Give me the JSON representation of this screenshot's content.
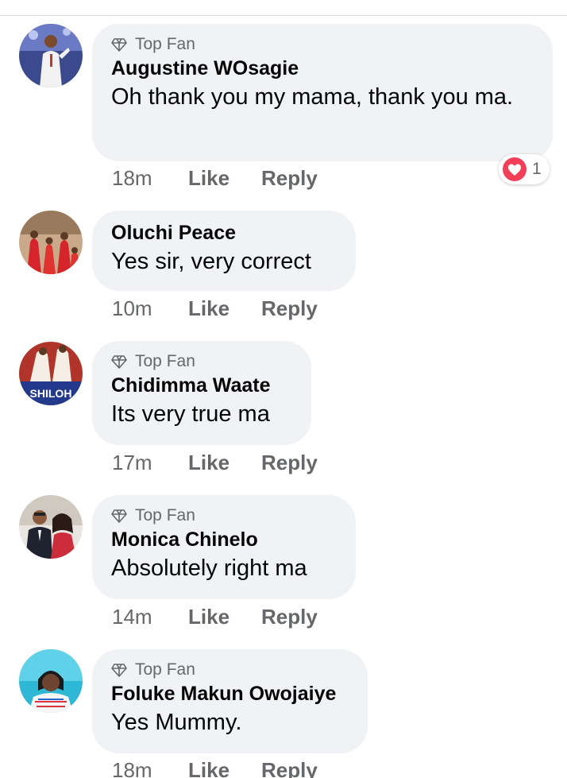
{
  "comments": [
    {
      "badge": "Top Fan",
      "name": "Augustine WOsagie",
      "text": "Oh thank you my mama, thank you ma.",
      "time": "18m",
      "like": "Like",
      "reply": "Reply",
      "reaction": {
        "icon": "heart-reaction-icon",
        "count": "1"
      }
    },
    {
      "name": "Oluchi Peace",
      "text": "Yes sir, very correct",
      "time": "10m",
      "like": "Like",
      "reply": "Reply"
    },
    {
      "badge": "Top Fan",
      "name": "Chidimma Waate",
      "text": "Its very true ma",
      "time": "17m",
      "like": "Like",
      "reply": "Reply",
      "avatar_text": "SHILOH"
    },
    {
      "badge": "Top Fan",
      "name": "Monica Chinelo",
      "text": "Absolutely right ma",
      "time": "14m",
      "like": "Like",
      "reply": "Reply"
    },
    {
      "badge": "Top Fan",
      "name": "Foluke Makun Owojaiye",
      "text": "Yes Mummy.",
      "time": "18m",
      "like": "Like",
      "reply": "Reply"
    }
  ],
  "colors": {
    "bubble": "#f0f2f5",
    "meta_text": "#65676b",
    "name_text": "#050505",
    "heart": "#f33e58"
  }
}
